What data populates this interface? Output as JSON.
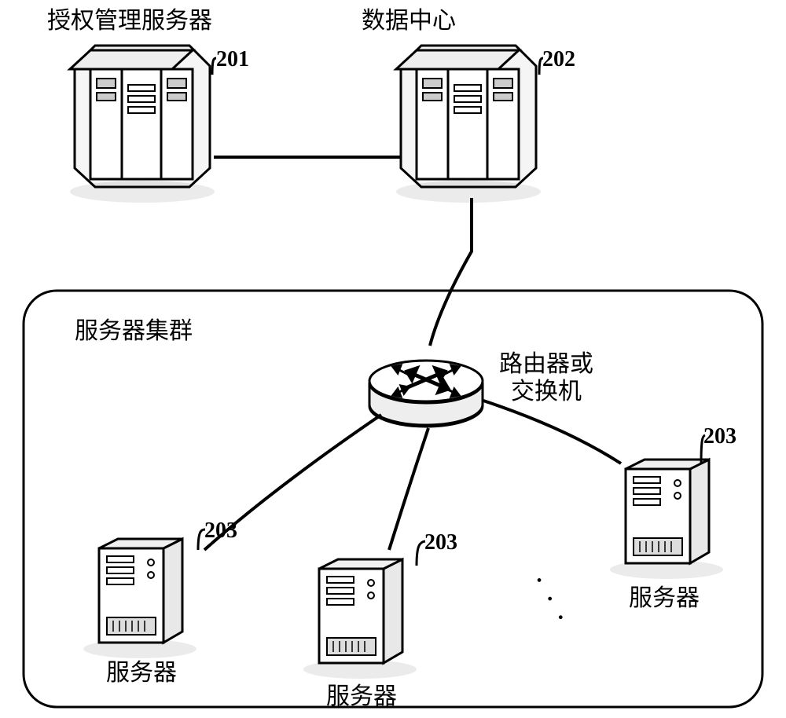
{
  "labels": {
    "auth_server_title": "授权管理服务器",
    "data_center_title": "数据中心",
    "cluster_title": "服务器集群",
    "router_switch_line1": "路由器或",
    "router_switch_line2": "交换机",
    "server_caption": "服务器"
  },
  "refs": {
    "auth_server": "201",
    "data_center": "202",
    "cluster_server": "203"
  },
  "ellipsis": "· · ·"
}
